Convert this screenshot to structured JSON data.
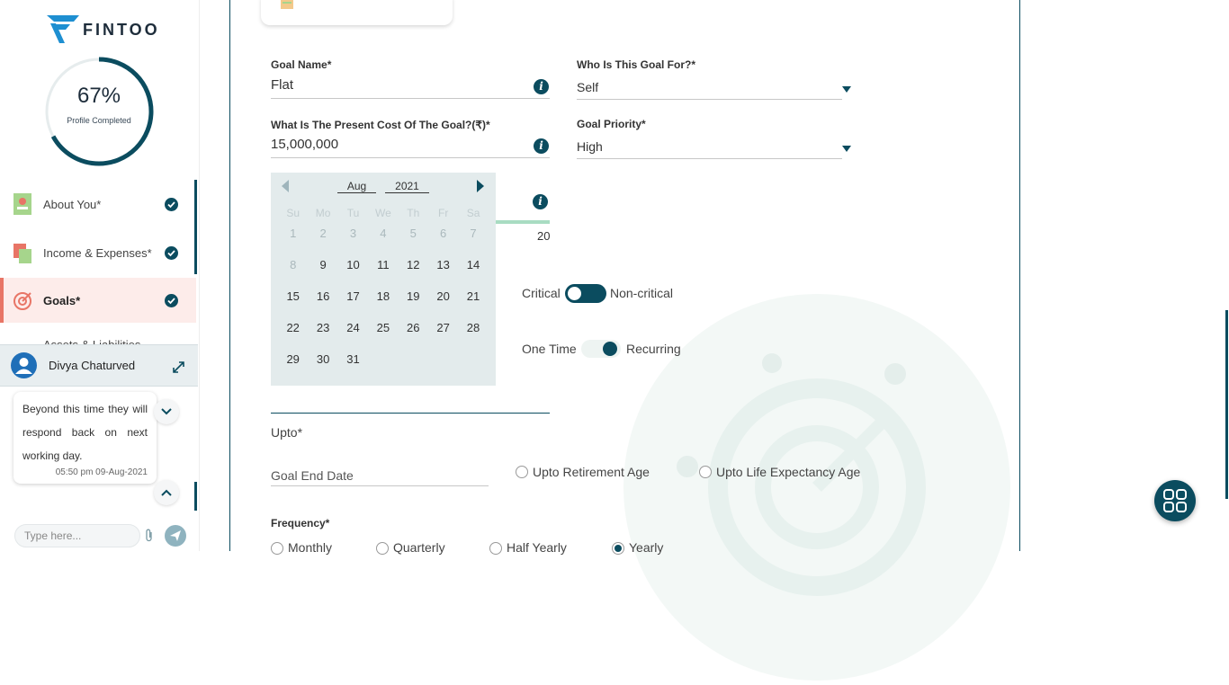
{
  "brand": {
    "name": "FINTOO"
  },
  "profile": {
    "percent": "67%",
    "percent_value": 0.67,
    "label": "Profile Completed"
  },
  "sidebar": {
    "items": [
      {
        "label": "About You*",
        "done": true
      },
      {
        "label": "Income & Expenses*",
        "done": true
      },
      {
        "label": "Goals*",
        "done": true
      },
      {
        "label": "Assets & Liabilities"
      }
    ]
  },
  "chat": {
    "agent_name": "Divya Chaturved",
    "message": "Beyond this time they will respond back on next working day.",
    "message_time": "05:50 pm 09-Aug-2021",
    "input_placeholder": "Type here..."
  },
  "form": {
    "goal_name": {
      "label": "Goal Name*",
      "value": "Flat"
    },
    "goal_for": {
      "label": "Who Is This Goal For?*",
      "value": "Self"
    },
    "present_cost": {
      "label": "What Is The Present Cost Of The Goal?(₹)*",
      "value": "15,000,000"
    },
    "priority": {
      "label": "Goal Priority*",
      "value": "High"
    },
    "slider_value": "20",
    "criticality": {
      "left": "Critical",
      "right": "Non-critical"
    },
    "occurrence": {
      "left": "One Time",
      "right": "Recurring"
    },
    "upto_label": "Upto*",
    "end_date_placeholder": "Goal End Date",
    "upto_options": [
      "Upto Retirement Age",
      "Upto Life Expectancy Age"
    ],
    "frequency": {
      "label": "Frequency*",
      "options": [
        "Monthly",
        "Quarterly",
        "Half Yearly",
        "Yearly"
      ],
      "selected": "Yearly"
    }
  },
  "calendar": {
    "month": "Aug",
    "year": "2021",
    "day_headers": [
      "Su",
      "Mo",
      "Tu",
      "We",
      "Th",
      "Fr",
      "Sa"
    ],
    "rows": [
      [
        "1",
        "2",
        "3",
        "4",
        "5",
        "6",
        "7"
      ],
      [
        "8",
        "9",
        "10",
        "11",
        "12",
        "13",
        "14"
      ],
      [
        "15",
        "16",
        "17",
        "18",
        "19",
        "20",
        "21"
      ],
      [
        "22",
        "23",
        "24",
        "25",
        "26",
        "27",
        "28"
      ],
      [
        "29",
        "30",
        "31",
        "",
        "",
        "",
        ""
      ]
    ]
  },
  "colors": {
    "primary": "#0b4c5f",
    "accent": "#e87566"
  }
}
